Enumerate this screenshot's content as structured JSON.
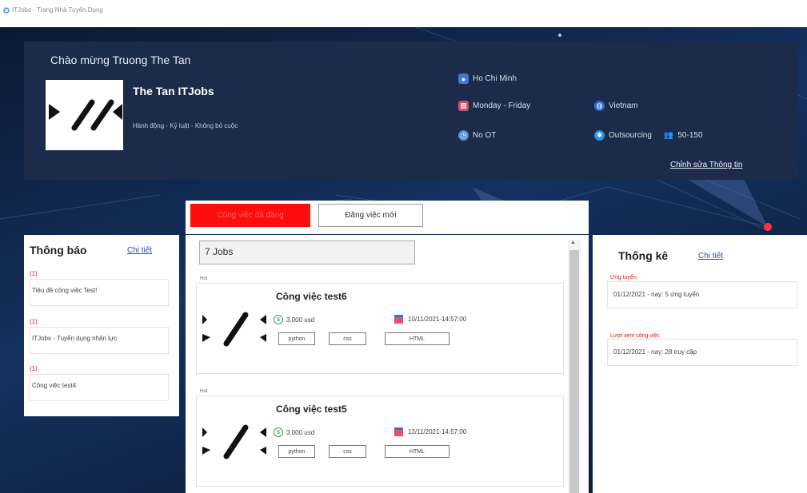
{
  "window": {
    "title": "ITJobs - Trang Nhà Tuyển Dụng"
  },
  "header": {
    "welcome": "Chào mừng Truong The Tan",
    "company_name": "The Tan ITJobs",
    "company_tags": "Hành động - Kỷ luật - Không bỏ cuộc",
    "location": "Ho Chi Minh",
    "work_days": "Monday - Friday",
    "overtime": "No OT",
    "country": "Vietnam",
    "company_type": "Outsourcing",
    "company_size": "50-150",
    "edit_link": "Chỉnh sửa Thông tin"
  },
  "tabs": {
    "posted": "Công việc đã đăng",
    "new": "Đăng việc mới"
  },
  "notifications": {
    "title": "Thông báo",
    "detail_link": "Chi tiết",
    "items": [
      {
        "count": "(1)",
        "text": "Tiêu đề công việc Test!"
      },
      {
        "count": "(1)",
        "text": "ITJobs - Tuyển dụng nhân lực"
      },
      {
        "count": "(1)",
        "text": "Công việc test4"
      }
    ]
  },
  "jobs": {
    "count_label": "7 Jobs",
    "items": [
      {
        "legend": "Hot",
        "title": "Công việc test6",
        "salary": "3.000 usd",
        "date": "10/11/2021-14:57:00",
        "skills": [
          "python",
          "css",
          "HTML"
        ]
      },
      {
        "legend": "Hot",
        "title": "Công việc test5",
        "salary": "3.000 usd",
        "date": "12/11/2021-14:57:00",
        "skills": [
          "python",
          "css",
          "HTML"
        ]
      }
    ]
  },
  "stats": {
    "title": "Thống kê",
    "detail_link": "Chi tiết",
    "sections": [
      {
        "label": "Ứng tuyển",
        "value": "01/12/2021 - nay: 5 ứng tuyển"
      },
      {
        "label": "Lượt xem công việc",
        "value": "01/12/2021 - nay: 28 truy cập"
      }
    ]
  },
  "colors": {
    "accent_red": "#ff0d0d",
    "header_bg": "#1c2b49",
    "link_blue": "#2a49c9"
  }
}
